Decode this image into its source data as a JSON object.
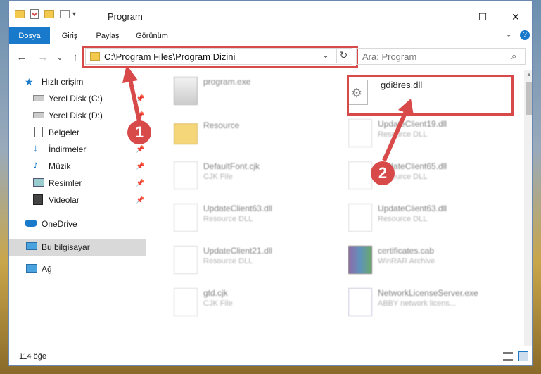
{
  "window": {
    "title": "Program",
    "minimize_glyph": "—",
    "maximize_glyph": "☐",
    "close_glyph": "✕"
  },
  "ribbon": {
    "tabs": [
      {
        "label": "Dosya",
        "active": true
      },
      {
        "label": "Giriş",
        "active": false
      },
      {
        "label": "Paylaş",
        "active": false
      },
      {
        "label": "Görünüm",
        "active": false
      }
    ]
  },
  "nav": {
    "back_glyph": "←",
    "forward_glyph": "→",
    "recent_glyph": "⌄",
    "up_glyph": "↑",
    "path": "C:\\Program Files\\Program Dizini",
    "refresh_glyph": "↻",
    "dropdown_glyph": "⌄",
    "search_placeholder": "Ara: Program"
  },
  "sidebar": {
    "items": [
      {
        "label": "Hızlı erişim",
        "icon": "star-icon",
        "pinned": false
      },
      {
        "label": "Yerel Disk (C:)",
        "icon": "drive-icon",
        "pinned": true
      },
      {
        "label": "Yerel Disk (D:)",
        "icon": "drive-icon",
        "pinned": true
      },
      {
        "label": "Belgeler",
        "icon": "documents-icon",
        "pinned": true
      },
      {
        "label": "İndirmeler",
        "icon": "download-icon",
        "pinned": true
      },
      {
        "label": "Müzik",
        "icon": "music-icon",
        "pinned": true
      },
      {
        "label": "Resimler",
        "icon": "pictures-icon",
        "pinned": true
      },
      {
        "label": "Videolar",
        "icon": "videos-icon",
        "pinned": true
      },
      {
        "label": "OneDrive",
        "icon": "cloud-icon",
        "pinned": false
      },
      {
        "label": "Bu bilgisayar",
        "icon": "computer-icon",
        "pinned": false
      },
      {
        "label": "Ağ",
        "icon": "network-icon",
        "pinned": false
      }
    ]
  },
  "files": [
    {
      "name": "program.exe",
      "type": "",
      "icon": "exe-icon"
    },
    {
      "name": "gdi8res.dll",
      "type": "",
      "icon": "dll-gear-icon"
    },
    {
      "name": "Resource",
      "type": "",
      "icon": "folder-icon"
    },
    {
      "name": "UpdateClient19.dll",
      "type": "Resource DLL",
      "icon": "dll-gear-icon"
    },
    {
      "name": "DefaultFont.cjk",
      "type": "CJK File",
      "icon": "file-icon"
    },
    {
      "name": "UpdateClient65.dll",
      "type": "Resource DLL",
      "icon": "dll-gear-icon"
    },
    {
      "name": "UpdateClient63.dll",
      "type": "Resource DLL",
      "icon": "dll-gear-icon"
    },
    {
      "name": "UpdateClient63.dll",
      "type": "Resource DLL",
      "icon": "dll-gear-icon"
    },
    {
      "name": "UpdateClient21.dll",
      "type": "Resource DLL",
      "icon": "dll-gear-icon"
    },
    {
      "name": "certificates.cab",
      "type": "WinRAR Archive",
      "icon": "archive-icon"
    },
    {
      "name": "gtd.cjk",
      "type": "CJK File",
      "icon": "file-icon"
    },
    {
      "name": "NetworkLicenseServer.exe",
      "type": "ABBY network licens...",
      "icon": "exe-icon"
    }
  ],
  "status": {
    "count_text": "114 öğe"
  },
  "markers": {
    "one": "1",
    "two": "2"
  },
  "colors": {
    "accent": "#1979ca",
    "highlight": "#d84a4a"
  }
}
